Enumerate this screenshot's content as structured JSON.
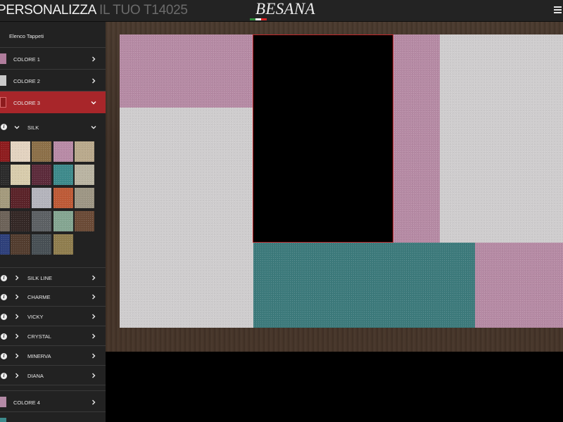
{
  "header": {
    "title_main": "PERSONALIZZA",
    "title_sub": " IL TUO T14025",
    "brand": "BESANA",
    "flag_colors": [
      "#2e8b3a",
      "#f2f2f2",
      "#d22"
    ]
  },
  "sidebar": {
    "list_label": "Elenco Tappeti",
    "colore1": {
      "label": "COLORE 1",
      "color": "#b07d9c"
    },
    "colore2": {
      "label": "COLORE 2",
      "color": "#c9c9c9"
    },
    "colore3": {
      "label": "COLORE 3",
      "color": "#8d1b1d"
    },
    "silk_label": "SILK",
    "swatches": [
      [
        "#8d1b1d",
        "#e3d3c0",
        "#8c6f48",
        "#b88aa6",
        "#b9a98c"
      ],
      [
        "#2a2a2a",
        "#d8ccac",
        "#5b2a3a",
        "#3d8a8b",
        "#b9b4a2"
      ],
      [
        "#a49a7c",
        "#5a2228",
        "#b4b4bc",
        "#bd5a36",
        "#9d9684"
      ],
      [
        "#6c6258",
        "#332725",
        "#5c6063",
        "#84a591",
        "#6a4a36"
      ],
      [
        "#2d3f7a",
        "#523c2e",
        "#474f54",
        "#8f7d4e"
      ]
    ],
    "categories": [
      "SILK LINE",
      "CHARME",
      "VICKY",
      "CRYSTAL",
      "MINERVA",
      "DIANA"
    ],
    "colore4": {
      "label": "COLORE 4",
      "color": "#b48aa6"
    },
    "colore5": {
      "color": "#3d8a8b"
    }
  },
  "rug": {
    "pink": "#b58aa4",
    "gray": "#cfcdce",
    "black": "#000000",
    "teal": "#3c7a7b",
    "selected_outline": "#c0282c"
  }
}
